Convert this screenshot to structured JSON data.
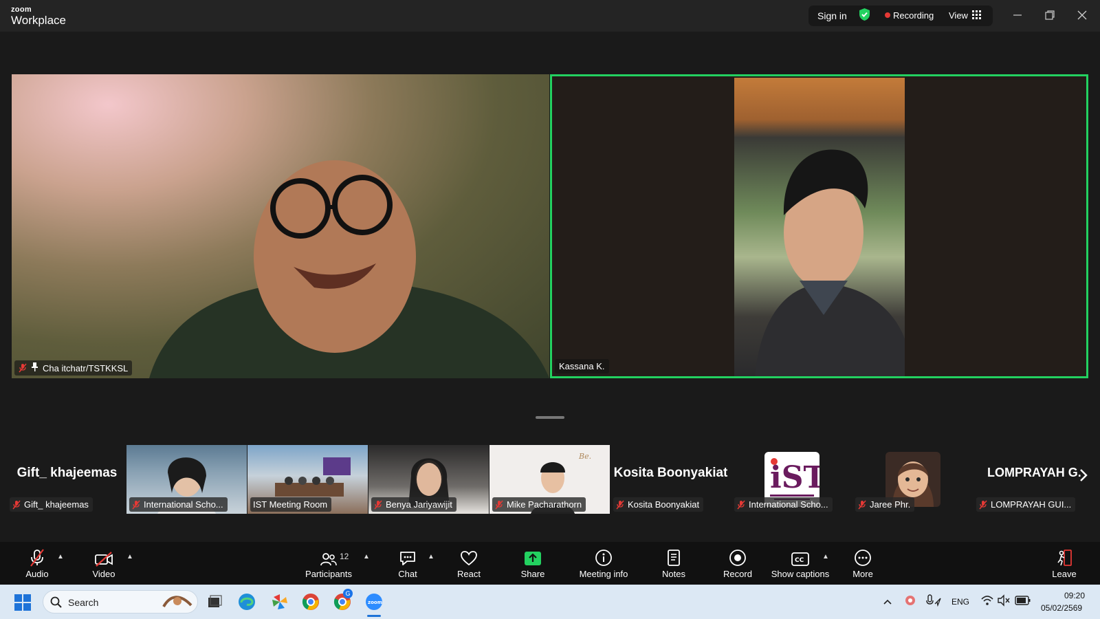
{
  "app": {
    "brand_small": "zoom",
    "brand_big": "Workplace"
  },
  "titlebar": {
    "sign_in": "Sign in",
    "recording": "Recording",
    "view": "View"
  },
  "main_videos": [
    {
      "name": "Cha itchatr/TSTKKSL",
      "muted": true,
      "pinned": true
    },
    {
      "name": "Kassana K.",
      "active_speaker": true
    }
  ],
  "thumbnails": [
    {
      "display_name": "Gift_ khajeemas",
      "tag": "Gift_ khajeemas",
      "type": "name"
    },
    {
      "tag": "International Scho...",
      "type": "video"
    },
    {
      "tag": "IST Meeting Room",
      "type": "video"
    },
    {
      "tag": "Benya Jariyawijit",
      "type": "video"
    },
    {
      "tag": "Mike Pacharathorn",
      "type": "video"
    },
    {
      "display_name": "Kosita Boonyakiat",
      "tag": "Kosita Boonyakiat",
      "type": "name"
    },
    {
      "tag": "International Scho...",
      "type": "avatar",
      "avatar": "IST logo"
    },
    {
      "tag": "Jaree Phr.",
      "type": "avatar",
      "avatar": "cartoon avatar"
    },
    {
      "display_name": "LOMPRAYAH G.",
      "tag": "LOMPRAYAH GUI...",
      "type": "name"
    }
  ],
  "toolbar": {
    "audio": "Audio",
    "video": "Video",
    "participants": "Participants",
    "participants_count": "12",
    "chat": "Chat",
    "react": "React",
    "share": "Share",
    "meeting_info": "Meeting info",
    "notes": "Notes",
    "record": "Record",
    "show_captions": "Show captions",
    "more": "More",
    "leave": "Leave"
  },
  "taskbar": {
    "search_placeholder": "Search",
    "language": "ENG",
    "time": "09:20",
    "date": "05/02/2569",
    "chrome_badge": "G"
  },
  "colors": {
    "active_speaker": "#23d160",
    "recording": "#e53935",
    "share": "#23d160"
  }
}
